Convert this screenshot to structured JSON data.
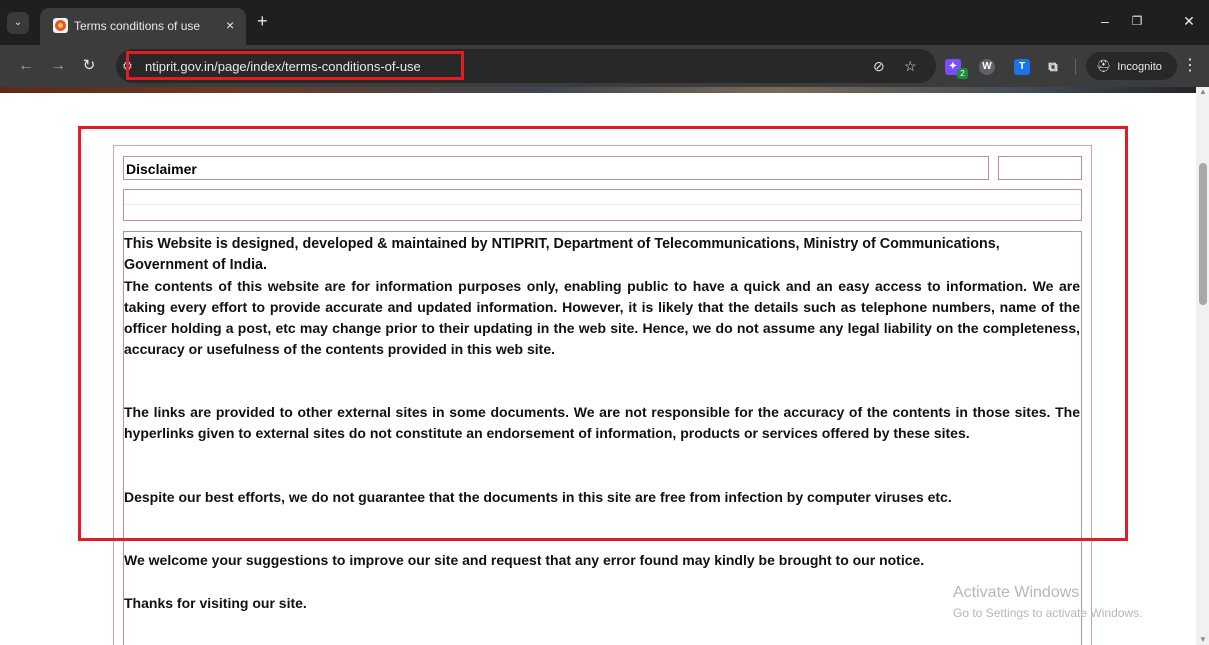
{
  "browser": {
    "tab_title": "Terms conditions of use",
    "tab_close": "×",
    "new_tab": "+",
    "url": "ntiprit.gov.in/page/index/terms-conditions-of-use",
    "incognito_label": "Incognito",
    "extension_badge": "2",
    "extensions": [
      {
        "name": "puzzle-extension-icon",
        "glyph": "✦",
        "color": "#8b5cf6"
      },
      {
        "name": "w-extension-icon",
        "glyph": "W",
        "color": "#5f6368"
      },
      {
        "name": "t-extension-icon",
        "glyph": "T",
        "color": "#1a73e8"
      }
    ]
  },
  "page": {
    "title": "Disclaimer",
    "paragraph_1": "This Website is designed, developed & maintained by NTIPRIT, Department of Telecommunications, Ministry of Communications, Government of India.",
    "paragraph_2": "The contents of this website are for information purposes only,  enabling public to have a quick and an easy access to information.  We are taking every effort to provide accurate and updated information. However, it is likely that the details such as telephone numbers, name of the officer holding a post, etc may change prior to their updating in the web site. Hence, we do not assume any legal liability on the completeness, accuracy or usefulness of the contents provided in this web site.",
    "paragraph_3": "The links are provided to other external sites in some documents. We are not responsible for the accuracy of the contents in those sites. The hyperlinks given to external sites do not constitute an endorsement of information, products or services offered by these sites.",
    "paragraph_4": "Despite our best efforts, we do not guarantee that the documents in this site are free from infection by computer viruses etc.",
    "paragraph_5": "We welcome your suggestions to improve our site and request that any error found may kindly be brought to our notice.",
    "paragraph_6": "Thanks for visiting our site."
  },
  "watermark": {
    "line_1": "Activate Windows",
    "line_2": "Go to Settings to activate Windows."
  },
  "colors": {
    "highlight": "#e01c24",
    "panel_border": "#c98d8d"
  }
}
